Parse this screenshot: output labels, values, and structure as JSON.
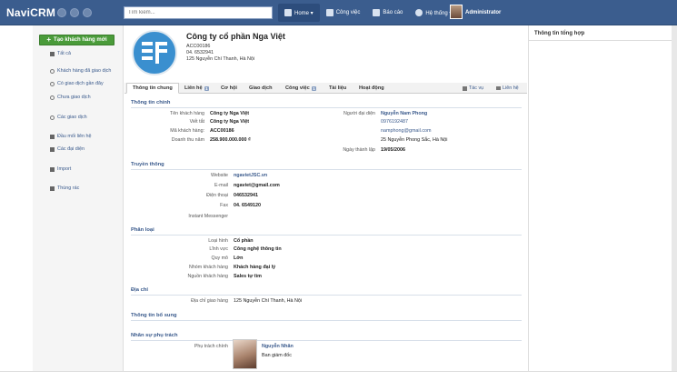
{
  "app": {
    "title": "NaviCRM"
  },
  "search": {
    "placeholder": "Tìm kiếm..."
  },
  "nav": {
    "items": [
      {
        "label": "Home ▾"
      },
      {
        "label": "Công việc"
      },
      {
        "label": "Báo cáo"
      },
      {
        "label": "Hệ thống ▾"
      }
    ],
    "user": "Administrator"
  },
  "sidebar": {
    "new_button": "Tạo khách hàng mới",
    "items": [
      {
        "label": "Tất cả"
      },
      {
        "label": "Khách hàng đã giao dịch"
      },
      {
        "label": "Có giao dịch gần đây"
      },
      {
        "label": "Chưa giao dịch"
      },
      {
        "label": "Các giao dịch"
      },
      {
        "label": "Đầu mối liên hệ"
      },
      {
        "label": "Các đại diện"
      },
      {
        "label": "Import"
      },
      {
        "label": "Thùng rác"
      }
    ]
  },
  "company": {
    "name": "Công ty cổ phần Nga Việt",
    "code": "ACC00186",
    "phone": "04. 6532941",
    "address": "125 Nguyễn Chí Thanh, Hà Nội"
  },
  "tabs": [
    {
      "label": "Thông tin chung"
    },
    {
      "label": "Liên hệ",
      "badge": "1"
    },
    {
      "label": "Cơ hội"
    },
    {
      "label": "Giao dịch"
    },
    {
      "label": "Công việc",
      "badge": "1"
    },
    {
      "label": "Tài liệu"
    },
    {
      "label": "Hoạt động"
    }
  ],
  "tab_actions": {
    "tasks": "Tác vụ",
    "contact": "Liên hệ"
  },
  "sections": {
    "main_info": "Thông tin chính",
    "media": "Truyền thông",
    "classification": "Phân loại",
    "address": "Địa chỉ",
    "extra": "Thông tin bổ sung",
    "staff": "Nhân sự phụ trách"
  },
  "main_info": {
    "fields": [
      {
        "label": "Tên khách hàng",
        "value": "Công ty Nga Việt"
      },
      {
        "label": "Viết tắt",
        "value": "Công ty Nga Việt"
      },
      {
        "label": "Mã khách hàng:",
        "value": "ACC00186"
      },
      {
        "label": "Doanh thu năm",
        "value": "258.900.000.000 ₫"
      }
    ],
    "rep_label": "Người đại diện",
    "rep_name": "Nguyễn Nam Phong",
    "rep_phone": "0976192487",
    "rep_email": "namphong@gmail.com",
    "rep_address": "25 Nguyễn Phong Sắc, Hà Nội",
    "founded_label": "Ngày thành lập",
    "founded_value": "19/05/2006"
  },
  "media": {
    "fields": [
      {
        "label": "Website",
        "value": "ngavietJSC.vn"
      },
      {
        "label": "E-mail",
        "value": "ngaviet@gmail.com"
      },
      {
        "label": "Điện thoại",
        "value": "046532941"
      },
      {
        "label": "Fax",
        "value": "04. 6549120"
      },
      {
        "label": "Instant Messenger",
        "value": ""
      }
    ]
  },
  "classification": {
    "fields": [
      {
        "label": "Loại hình",
        "value": "Cổ phần"
      },
      {
        "label": "Lĩnh vực",
        "value": "Công nghệ thông tin"
      },
      {
        "label": "Quy mô",
        "value": "Lớn"
      },
      {
        "label": "Nhóm khách hàng",
        "value": "Khách hàng đại lý"
      },
      {
        "label": "Nguồn khách hàng",
        "value": "Sales tự tìm"
      }
    ]
  },
  "address": {
    "label": "Địa chỉ giao hàng",
    "value": "125 Nguyễn Chí Thanh, Hà Nội"
  },
  "staff": {
    "label": "Phụ trách chính",
    "name": "Nguyễn Nhân",
    "role": "Ban giám đốc"
  },
  "right_panel": {
    "title": "Thông tin tổng hợp"
  },
  "colors": {
    "topbar": "#3b5d8e",
    "accent_green": "#4a9b3a",
    "link": "#3a5a8c"
  }
}
